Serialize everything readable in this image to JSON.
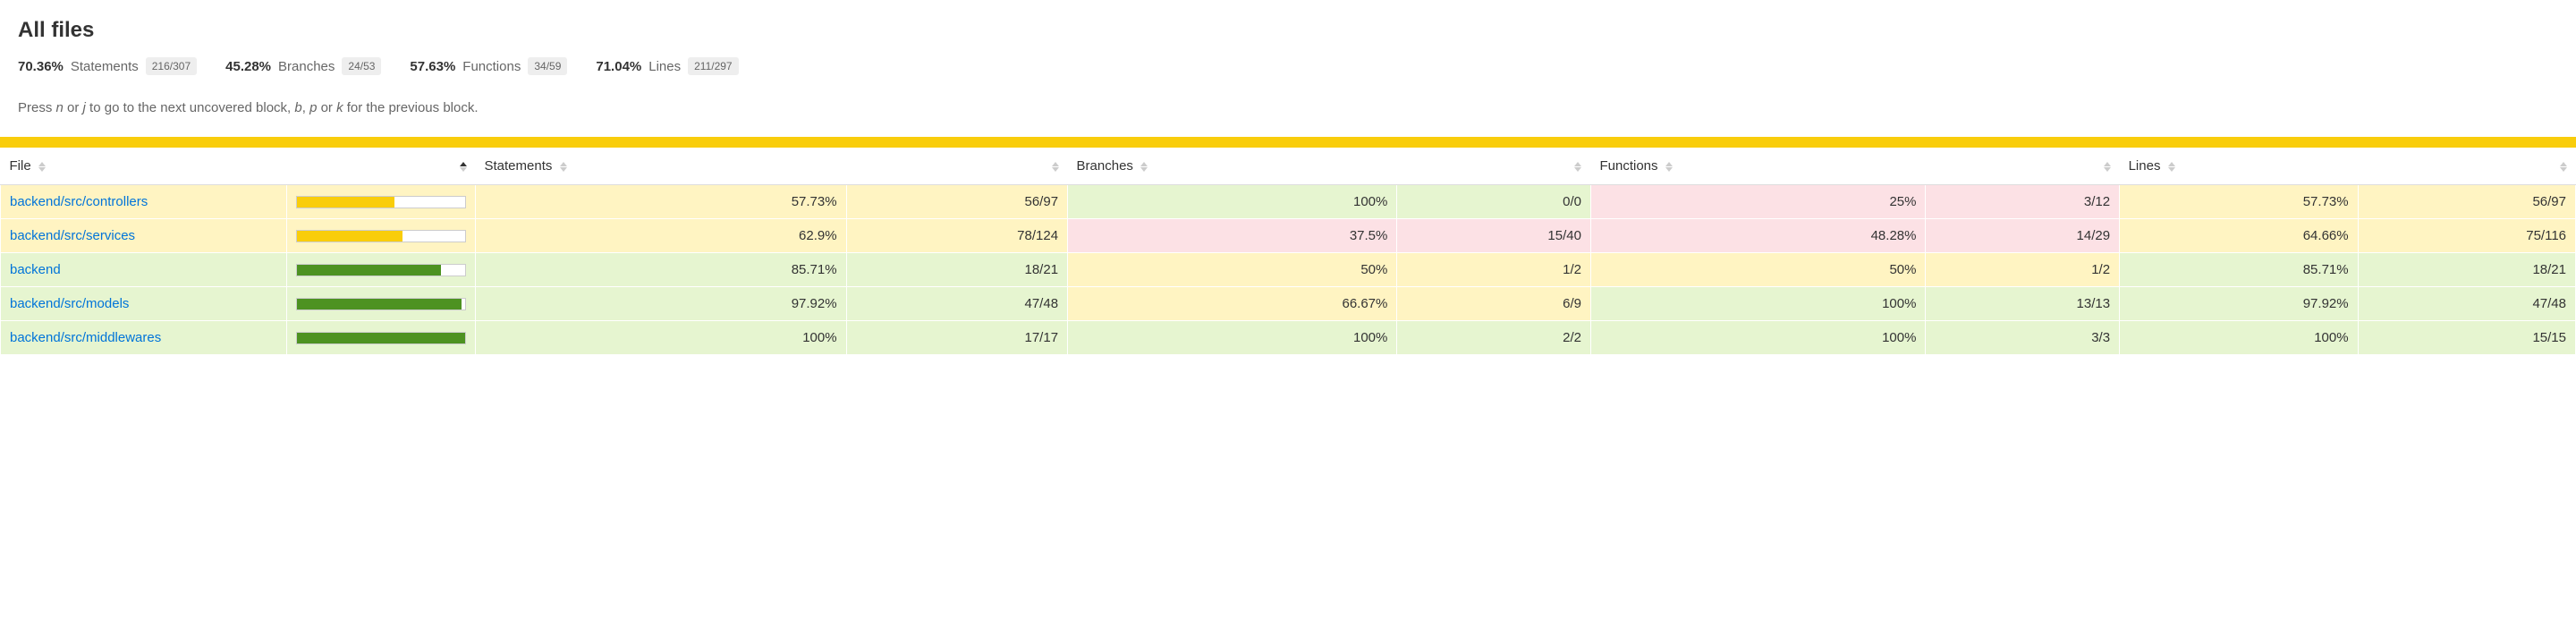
{
  "title": "All files",
  "summary": {
    "statements": {
      "pct": "70.36%",
      "label": "Statements",
      "fraction": "216/307"
    },
    "branches": {
      "pct": "45.28%",
      "label": "Branches",
      "fraction": "24/53"
    },
    "functions": {
      "pct": "57.63%",
      "label": "Functions",
      "fraction": "34/59"
    },
    "lines": {
      "pct": "71.04%",
      "label": "Lines",
      "fraction": "211/297"
    }
  },
  "help_prefix": "Press ",
  "help_key_n": "n",
  "help_or1": " or ",
  "help_key_j": "j",
  "help_mid": " to go to the next uncovered block, ",
  "help_key_b": "b",
  "help_comma": ", ",
  "help_key_p": "p",
  "help_or2": " or ",
  "help_key_k": "k",
  "help_suffix": " for the previous block.",
  "columns": {
    "file": "File",
    "statements": "Statements",
    "branches": "Branches",
    "functions": "Functions",
    "lines": "Lines"
  },
  "rows": [
    {
      "file": "backend/src/controllers",
      "bar_pct": 57.73,
      "bar_level": "medium",
      "stmt_pct": "57.73%",
      "stmt_frac": "56/97",
      "stmt_level": "medium",
      "branch_pct": "100%",
      "branch_frac": "0/0",
      "branch_level": "high",
      "func_pct": "25%",
      "func_frac": "3/12",
      "func_level": "low",
      "line_pct": "57.73%",
      "line_frac": "56/97",
      "line_level": "medium"
    },
    {
      "file": "backend/src/services",
      "bar_pct": 62.9,
      "bar_level": "medium",
      "stmt_pct": "62.9%",
      "stmt_frac": "78/124",
      "stmt_level": "medium",
      "branch_pct": "37.5%",
      "branch_frac": "15/40",
      "branch_level": "low",
      "func_pct": "48.28%",
      "func_frac": "14/29",
      "func_level": "low",
      "line_pct": "64.66%",
      "line_frac": "75/116",
      "line_level": "medium"
    },
    {
      "file": "backend",
      "bar_pct": 85.71,
      "bar_level": "high",
      "stmt_pct": "85.71%",
      "stmt_frac": "18/21",
      "stmt_level": "high",
      "branch_pct": "50%",
      "branch_frac": "1/2",
      "branch_level": "medium",
      "func_pct": "50%",
      "func_frac": "1/2",
      "func_level": "medium",
      "line_pct": "85.71%",
      "line_frac": "18/21",
      "line_level": "high"
    },
    {
      "file": "backend/src/models",
      "bar_pct": 97.92,
      "bar_level": "high",
      "stmt_pct": "97.92%",
      "stmt_frac": "47/48",
      "stmt_level": "high",
      "branch_pct": "66.67%",
      "branch_frac": "6/9",
      "branch_level": "medium",
      "func_pct": "100%",
      "func_frac": "13/13",
      "func_level": "high",
      "line_pct": "97.92%",
      "line_frac": "47/48",
      "line_level": "high"
    },
    {
      "file": "backend/src/middlewares",
      "bar_pct": 100,
      "bar_level": "high",
      "stmt_pct": "100%",
      "stmt_frac": "17/17",
      "stmt_level": "high",
      "branch_pct": "100%",
      "branch_frac": "2/2",
      "branch_level": "high",
      "func_pct": "100%",
      "func_frac": "3/3",
      "func_level": "high",
      "line_pct": "100%",
      "line_frac": "15/15",
      "line_level": "high"
    }
  ]
}
